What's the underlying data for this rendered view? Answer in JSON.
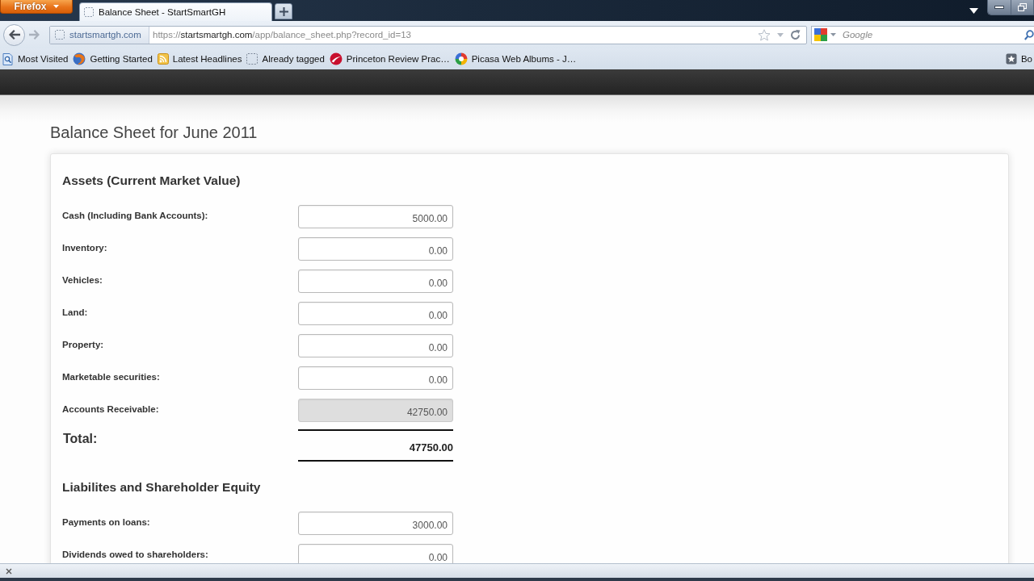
{
  "browser": {
    "menu_button": "Firefox",
    "tabs": [
      {
        "title": "Balance Sheet - StartSmartGH",
        "selected": true
      }
    ],
    "address_bar": {
      "site_identity": "startsmartgh.com",
      "url": {
        "scheme": "https://",
        "host": "startsmartgh.com",
        "path": "/app/balance_sheet.php?record_id=13"
      }
    },
    "search": {
      "placeholder": "Google"
    },
    "bookmarks": [
      {
        "label": "Most Visited",
        "kind": "smart"
      },
      {
        "label": "Getting Started",
        "kind": "globe"
      },
      {
        "label": "Latest Headlines",
        "kind": "feed"
      },
      {
        "label": "Already tagged",
        "kind": "page"
      },
      {
        "label": "Princeton Review Prac…",
        "kind": "swoosh"
      },
      {
        "label": "Picasa Web Albums - J…",
        "kind": "pinwheel"
      }
    ],
    "bookmarks_menu": "Bo"
  },
  "page": {
    "title": "Balance Sheet for June 2011",
    "sections": [
      {
        "heading": "Assets (Current Market Value)",
        "rows": [
          {
            "label": "Cash (Including Bank Accounts):",
            "value": "5000.00",
            "disabled": false
          },
          {
            "label": "Inventory:",
            "value": "0.00",
            "disabled": false
          },
          {
            "label": "Vehicles:",
            "value": "0.00",
            "disabled": false
          },
          {
            "label": "Land:",
            "value": "0.00",
            "disabled": false
          },
          {
            "label": "Property:",
            "value": "0.00",
            "disabled": false
          },
          {
            "label": "Marketable securities:",
            "value": "0.00",
            "disabled": false
          },
          {
            "label": "Accounts Receivable:",
            "value": "42750.00",
            "disabled": true
          }
        ],
        "total": {
          "label": "Total:",
          "value": "47750.00"
        }
      },
      {
        "heading": "Liabilites and Shareholder Equity",
        "rows": [
          {
            "label": "Payments on loans:",
            "value": "3000.00",
            "disabled": false
          },
          {
            "label": "Dividends owed to shareholders:",
            "value": "0.00",
            "disabled": false
          }
        ]
      }
    ]
  }
}
